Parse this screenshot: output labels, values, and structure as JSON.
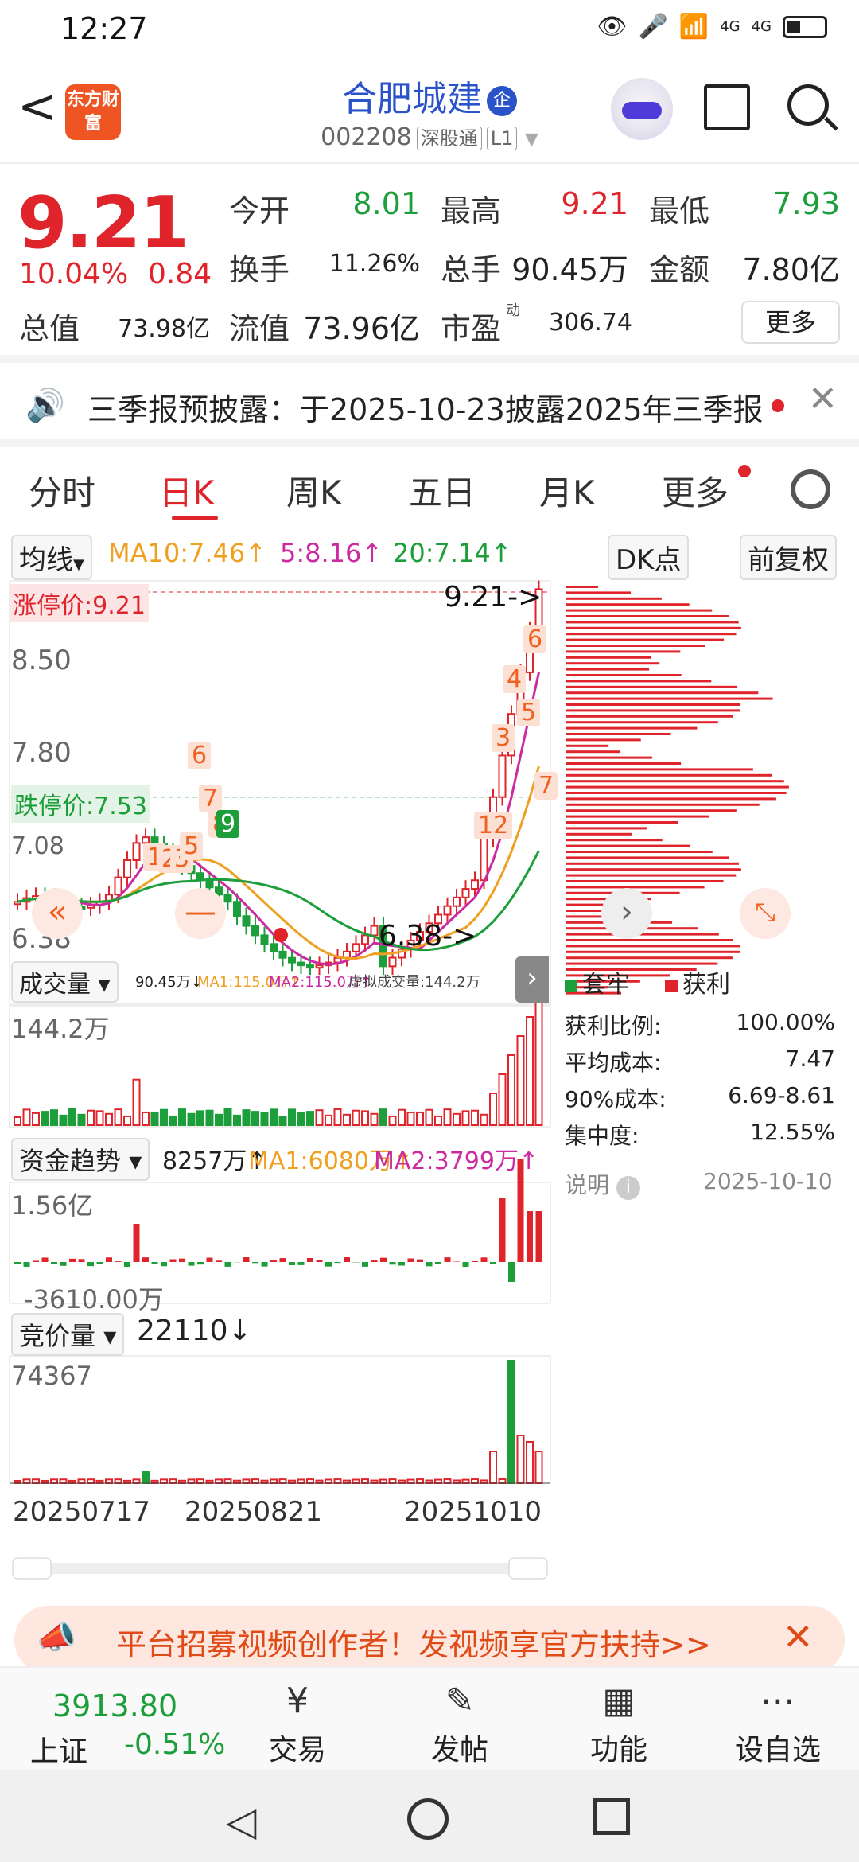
{
  "status": {
    "time": "12:27",
    "net1": "4G",
    "net2": "4G"
  },
  "header": {
    "logo_text": "东方财富",
    "stock_name": "合肥城建",
    "badge": "企",
    "code": "002208",
    "tag1": "深股通",
    "tag2": "L1"
  },
  "quote": {
    "price": "9.21",
    "pct": "10.04%",
    "chg": "0.84",
    "open_label": "今开",
    "open": "8.01",
    "high_label": "最高",
    "high": "9.21",
    "low_label": "最低",
    "low": "7.93",
    "turnover_label": "换手",
    "turnover": "11.26%",
    "volume_label": "总手",
    "volume": "90.45万",
    "amount_label": "金额",
    "amount": "7.80亿",
    "mcap_label": "总值",
    "mcap": "73.98亿",
    "float_label": "流值",
    "float": "73.96亿",
    "pe_label": "市盈",
    "pe_sup": "动",
    "pe": "306.74",
    "more": "更多"
  },
  "notice": {
    "text": "三季报预披露：于2025-10-23披露2025年三季报"
  },
  "tabs": [
    "分时",
    "日K",
    "周K",
    "五日",
    "月K",
    "更多"
  ],
  "active_tab": "日K",
  "ma_bar": {
    "label": "均线",
    "ma10": "MA10:7.46↑",
    "ma5": "5:8.16↑",
    "ma20": "20:7.14↑",
    "dk": "DK点",
    "fq": "前复权"
  },
  "kchart": {
    "limit_up": "涨停价:9.21",
    "limit_down": "跌停价:7.53",
    "y_top": "8.50",
    "y_mid": "7.80",
    "y_low": "7.08",
    "y_bottom": "6.38",
    "max_label": "9.21->",
    "min_label": "6.38->",
    "seq_marks": [
      "6",
      "7",
      "8",
      "9",
      "1",
      "2",
      "3",
      "5",
      "12",
      "3",
      "4",
      "5",
      "6",
      "7"
    ]
  },
  "volume": {
    "label": "成交量",
    "vol": "90.45万↓",
    "ma1": "MA1:115.0万↑",
    "ma2": "MA2:115.0万↑",
    "virtual": "虚拟成交量:144.2万",
    "top": "144.2万"
  },
  "fund": {
    "label": "资金趋势",
    "val": "8257万↑",
    "ma1": "MA1:6080万↑",
    "ma2": "MA2:3799万↑",
    "top": "1.56亿",
    "bottom": "-3610.00万"
  },
  "auction": {
    "label": "竞价量",
    "val": "22110↓",
    "top": "74367"
  },
  "dates": [
    "20250717",
    "20250821",
    "20251010"
  ],
  "chip": {
    "legend_green": "套牢",
    "legend_red": "获利",
    "rows": [
      {
        "k": "获利比例:",
        "v": "100.00%"
      },
      {
        "k": "平均成本:",
        "v": "7.47"
      },
      {
        "k": "90%成本:",
        "v": "6.69-8.61"
      },
      {
        "k": "集中度:",
        "v": "12.55%"
      }
    ],
    "note": "说明",
    "date": "2025-10-10"
  },
  "banner": {
    "text": "平台招募视频创作者！发视频享官方扶持>>"
  },
  "tabbar": {
    "index_val": "3913.80",
    "index_name": "上证",
    "index_chg": "-0.51%",
    "items": [
      "交易",
      "发帖",
      "功能",
      "设自选"
    ]
  },
  "colors": {
    "up": "#e0242b",
    "down": "#1c9e3a",
    "ma10": "#f0a020",
    "ma5": "#cc2aa0",
    "ma20": "#1c9e3a"
  }
}
